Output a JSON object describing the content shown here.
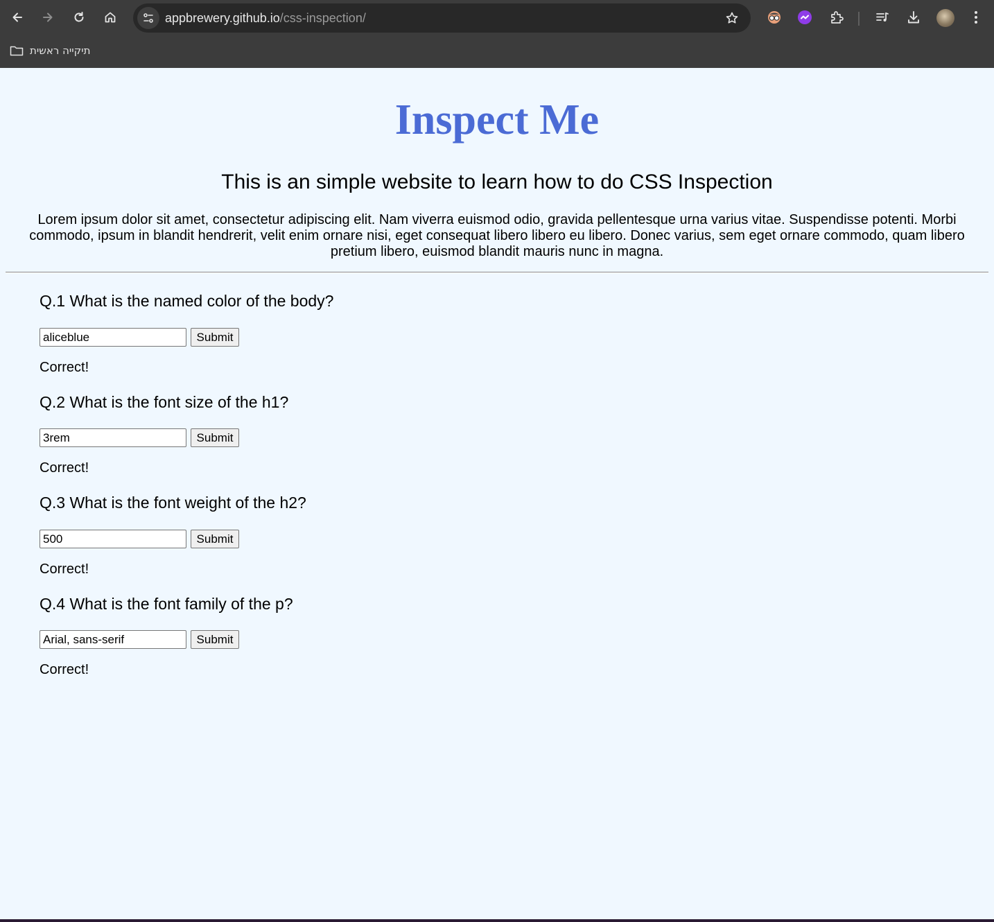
{
  "browser": {
    "url_host": "appbrewery.github.io",
    "url_path": "/css-inspection/",
    "bookmark_folder": "תיקייה ראשית",
    "icons": [
      "back-icon",
      "forward-icon",
      "reload-icon",
      "home-icon",
      "site-settings-icon",
      "star-icon",
      "extension-glasses-icon",
      "extension-purple-icon",
      "extensions-puzzle-icon",
      "media-queue-icon",
      "download-icon",
      "profile-avatar",
      "menu-kebab-icon"
    ]
  },
  "page": {
    "title": "Inspect Me",
    "subtitle": "This is an simple website to learn how to do CSS Inspection",
    "paragraph": "Lorem ipsum dolor sit amet, consectetur adipiscing elit. Nam viverra euismod odio, gravida pellentesque urna varius vitae. Suspendisse potenti. Morbi commodo, ipsum in blandit hendrerit, velit enim ornare nisi, eget consequat libero libero eu libero. Donec varius, sem eget ornare commodo, quam libero pretium libero, euismod blandit mauris nunc in magna.",
    "title_color": "#4b6bd5",
    "background_color": "#f0f8ff"
  },
  "questions": [
    {
      "label": "Q.1 What is the named color of the body?",
      "answer": "aliceblue",
      "button": "Submit",
      "result": "Correct!"
    },
    {
      "label": "Q.2 What is the font size of the h1?",
      "answer": "3rem",
      "button": "Submit",
      "result": "Correct!"
    },
    {
      "label": "Q.3 What is the font weight of the h2?",
      "answer": "500",
      "button": "Submit",
      "result": "Correct!"
    },
    {
      "label": "Q.4 What is the font family of the p?",
      "answer": "Arial, sans-serif",
      "button": "Submit",
      "result": "Correct!"
    }
  ]
}
